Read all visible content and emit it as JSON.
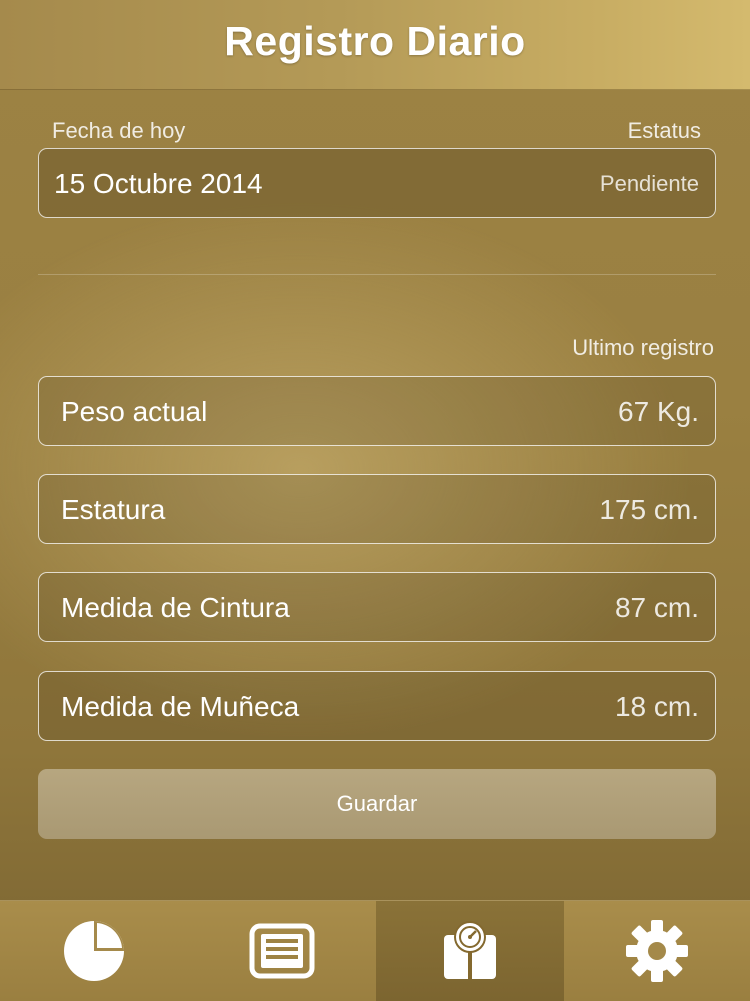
{
  "header": {
    "title": "Registro Diario"
  },
  "today": {
    "date_label": "Fecha de hoy",
    "status_label": "Estatus",
    "date_value": "15 Octubre 2014",
    "status_value": "Pendiente"
  },
  "last_record_label": "Ultimo registro",
  "measurements": [
    {
      "label": "Peso actual",
      "value": "67 Kg."
    },
    {
      "label": "Estatura",
      "value": "175 cm."
    },
    {
      "label": "Medida de Cintura",
      "value": "87 cm."
    },
    {
      "label": "Medida de Muñeca",
      "value": "18 cm."
    }
  ],
  "save_label": "Guardar",
  "tabbar": {
    "tabs": [
      {
        "icon": "pie-chart-icon",
        "active": false
      },
      {
        "icon": "list-icon",
        "active": false
      },
      {
        "icon": "scale-icon",
        "active": true
      },
      {
        "icon": "gear-icon",
        "active": false
      }
    ]
  },
  "colors": {
    "background": "#9a8041",
    "header": "#c8ad63",
    "text": "#ffffff"
  }
}
